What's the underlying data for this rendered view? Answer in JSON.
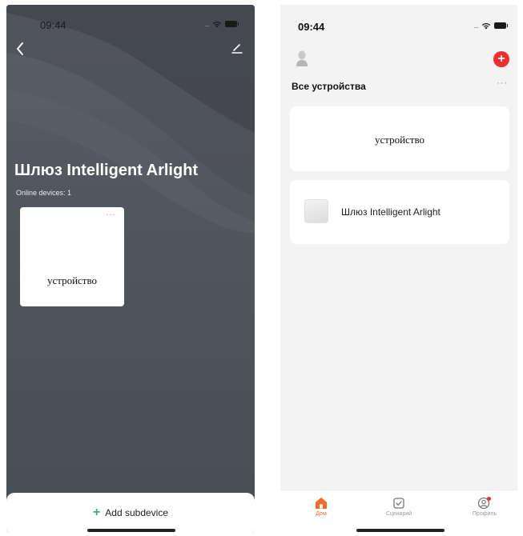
{
  "left_screen": {
    "status_time": "09:44",
    "gateway_title": "Шлюз Intelligent Arlight",
    "online_devices": "Online devices: 1",
    "subdevice_card": {
      "name": "устройство",
      "more": "···"
    },
    "add_subdevice": {
      "icon": "+",
      "label": "Add subdevice"
    }
  },
  "right_screen": {
    "status_time": "09:44",
    "header": {
      "add_icon": "+",
      "section_title": "Все устройства",
      "more": "···"
    },
    "devices": [
      {
        "name": "устройство"
      },
      {
        "name": "Шлюз Intelligent Arlight"
      }
    ],
    "tabs": [
      {
        "label": "Дом",
        "icon": "home-icon",
        "active": true
      },
      {
        "label": "Сценарий",
        "icon": "scene-icon",
        "active": false
      },
      {
        "label": "Профиль",
        "icon": "profile-icon",
        "active": false
      }
    ]
  },
  "colors": {
    "accent_orange": "#f36b2b",
    "add_red": "#f02d2d",
    "add_green": "#2fae8a",
    "dark_bg": "#51565d"
  }
}
